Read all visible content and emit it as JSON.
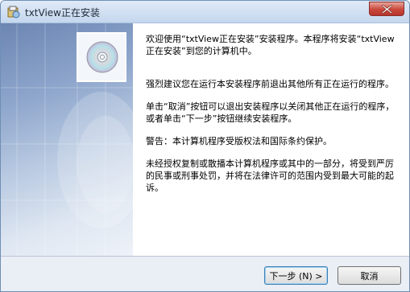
{
  "window": {
    "title": "txtView正在安装",
    "app_icon": "installer-app-icon",
    "close_icon": "close-icon"
  },
  "banner": {
    "image": "cd-disc-icon"
  },
  "message": {
    "welcome": "欢迎使用“txtView正在安装”安装程序。本程序将安装“txtView正在安装”到您的计算机中。",
    "recommend": "强烈建议您在运行本安装程序前退出其他所有正在运行的程序。",
    "cancel_hint": "单击“取消”按钮可以退出安装程序以关闭其他正在运行的程序，或者单击“下一步”按钮继续安装程序。",
    "warning": "警告：本计算机程序受版权法和国际条约保护。",
    "legal": "未经授权复制或散播本计算机程序或其中的一部分，将受到严厉的民事或刑事处罚，并将在法律许可的范围内受到最大可能的起诉。"
  },
  "buttons": {
    "next_label": "下一步 (N) >",
    "cancel_label": "取消"
  },
  "colors": {
    "close_red": "#c9473a",
    "banner_blue": "#6c86b3"
  }
}
